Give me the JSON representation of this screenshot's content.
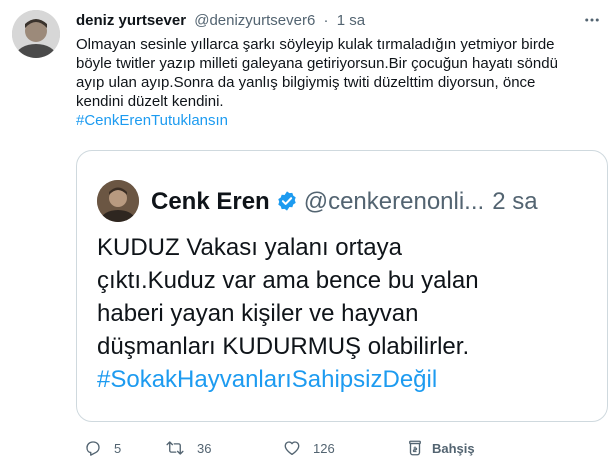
{
  "tweet": {
    "display_name": "deniz yurtsever",
    "handle": "@denizyurtsever6",
    "separator": "·",
    "time": "1 sa",
    "lines": [
      "Olmayan sesinle yıllarca şarkı söyleyip kulak tırmaladığın yetmiyor birde",
      "böyle twitler yazıp milleti galeyana getiriyorsun.Bir çocuğun hayatı söndü",
      "ayıp ulan ayıp.Sonra da yanlış bilgiymiş twiti düzelttim diyorsun, önce",
      "kendini düzelt kendini."
    ],
    "hashtag": "#CenkErenTutuklansın"
  },
  "quote": {
    "display_name": "Cenk Eren",
    "handle": "@cenkerenonli...",
    "time": "2 sa",
    "lines": [
      "KUDUZ Vakası yalanı ortaya",
      "çıktı.Kuduz var ama bence bu yalan",
      "haberi yayan kişiler ve hayvan",
      "düşmanları KUDURMUŞ olabilirler."
    ],
    "hashtag": "#SokakHayvanlarıSahipsizDeğil"
  },
  "actions": {
    "reply_count": "5",
    "retweet_count": "36",
    "like_count": "126",
    "share_label": "Bahşiş"
  },
  "colors": {
    "accent": "#1d9bf0",
    "muted": "#536471",
    "text": "#0f1419",
    "border": "#cfd9de"
  },
  "icons": {
    "more": "more-horizontal-icon",
    "verified": "verified-badge-icon",
    "reply": "reply-icon",
    "retweet": "retweet-icon",
    "like": "heart-icon",
    "share": "tip-jar-icon"
  }
}
